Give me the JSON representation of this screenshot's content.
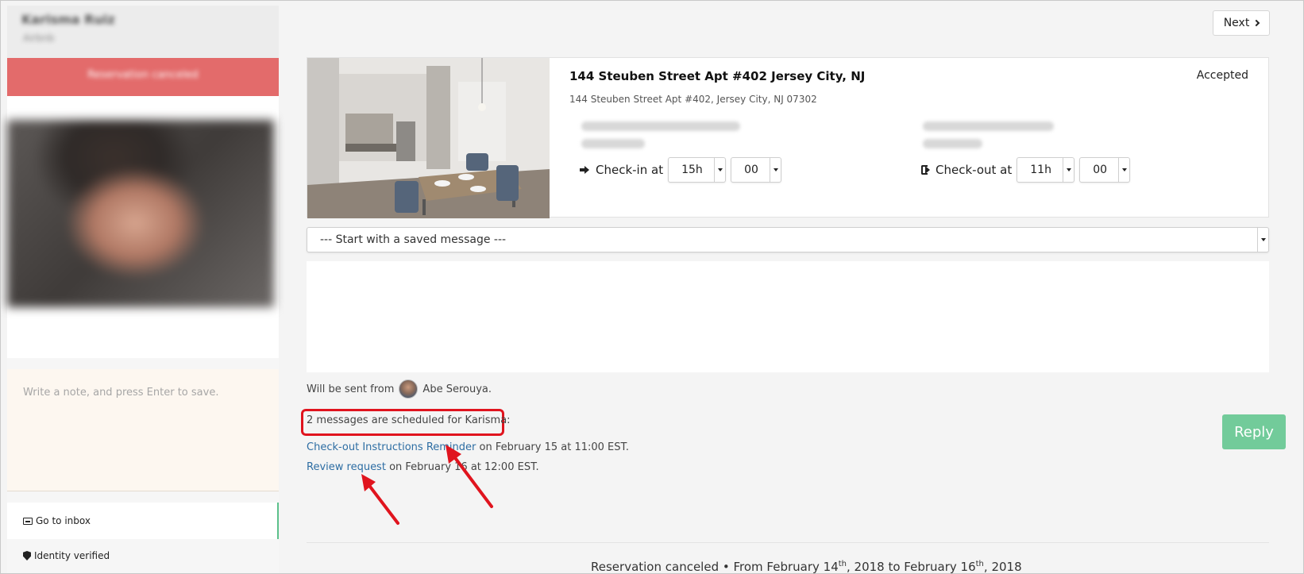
{
  "sidebar": {
    "guest_name": "Karisma Ruiz",
    "guest_subtitle": "Airbnb",
    "banner_text": "Reservation canceled",
    "note_placeholder": "Write a note, and press Enter to save.",
    "go_to_inbox_label": "Go to inbox",
    "identity_label": "Identity verified"
  },
  "header": {
    "next_label": "Next"
  },
  "reservation": {
    "address_title": "144 Steuben Street Apt #402 Jersey City, NJ",
    "address_full": "144 Steuben Street Apt #402, Jersey City, NJ 07302",
    "status": "Accepted",
    "checkin": {
      "label": "Check-in at",
      "hour": "15h",
      "minute": "00"
    },
    "checkout": {
      "label": "Check-out at",
      "hour": "11h",
      "minute": "00"
    }
  },
  "composer": {
    "saved_message_value": "--- Start with a saved message ---",
    "message_value": "",
    "sent_from_prefix": "Will be sent from",
    "sent_from_name": "Abe Serouya."
  },
  "scheduled": {
    "heading": "2 messages are scheduled for Karisma:",
    "items": [
      {
        "link": "Check-out Instructions Reminder",
        "when": "on February 15 at 11:00 EST."
      },
      {
        "link": "Review request",
        "when": "on February 16 at 12:00 EST."
      }
    ]
  },
  "actions": {
    "reply_label": "Reply"
  },
  "footer": {
    "prefix": "Reservation canceled • From February 14",
    "start_suffix": "th",
    "middle": ", 2018 to February 16",
    "end_suffix": "th",
    "year": ", 2018"
  },
  "colors": {
    "banner": "#e36b6b",
    "reply": "#72cb9a",
    "link": "#2d6da3",
    "highlight": "#e0141e"
  }
}
